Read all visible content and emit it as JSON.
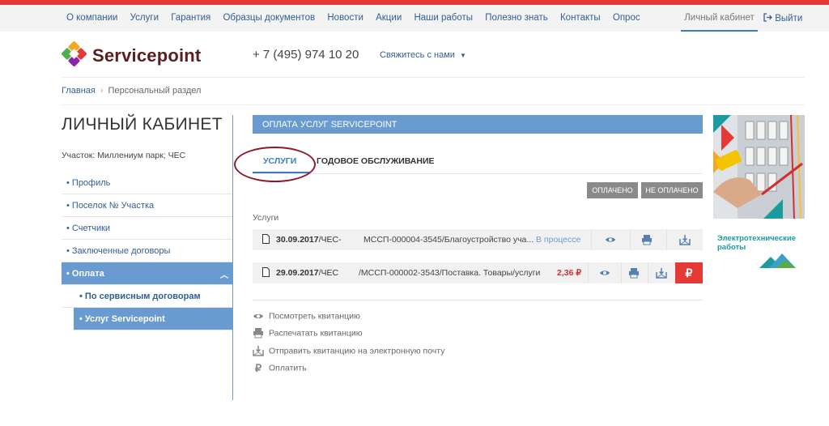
{
  "topnav": {
    "items": [
      "О компании",
      "Услуги",
      "Гарантия",
      "Образцы документов",
      "Новости",
      "Акции",
      "Наши работы",
      "Полезно знать",
      "Контакты",
      "Опрос"
    ],
    "cabinet": "Личный кабинет",
    "exit": "Выйти"
  },
  "header": {
    "logo_text": "Servicepoint",
    "phone": "+ 7 (495) 974 10 20",
    "contact": "Свяжитесь с нами"
  },
  "breadcrumb": {
    "home": "Главная",
    "current": "Персональный раздел"
  },
  "page": {
    "title": "ЛИЧНЫЙ КАБИНЕТ",
    "site_label": "Участок: Миллениум парк; ЧЕС"
  },
  "sidebar": {
    "items": [
      {
        "label": "• Профиль"
      },
      {
        "label": "• Поселок № Участка"
      },
      {
        "label": "• Счетчики"
      },
      {
        "label": "• Заключенные договоры"
      },
      {
        "label": "• Оплата"
      },
      {
        "label": "• По сервисным договорам"
      },
      {
        "label": "• Услуг Servicepoint"
      }
    ]
  },
  "panel": {
    "title": "ОПЛАТА УСЛУГ SERVICEPOINT",
    "tabs": [
      "УСЛУГИ",
      "ГОДОВОЕ ОБСЛУЖИВАНИЕ"
    ],
    "filters": {
      "paid": "ОПЛАЧЕНО",
      "unpaid": "НЕ ОПЛАЧЕНО"
    },
    "section_label": "Услуги",
    "rows": [
      {
        "date": "30.09.2017",
        "suffix": "/ЧЕС-",
        "desc": "МССП-000004-3545/Благоустройство уча...",
        "status": "В процессе"
      },
      {
        "date": "29.09.2017",
        "suffix": "/ЧЕС",
        "desc": "/МССП-000002-3543/Поставка. Товары/услуги",
        "amount": "2,36 ₽"
      }
    ],
    "rub_symbol": "₽",
    "legend": [
      {
        "icon": "eye-icon",
        "label": "Посмотреть квитанцию"
      },
      {
        "icon": "print-icon",
        "label": "Распечатать квитанцию"
      },
      {
        "icon": "mail-icon",
        "label": "Отправить квитанцию на электронную почту"
      },
      {
        "icon": "ruble-icon",
        "label": "Оплатить"
      }
    ]
  },
  "ad": {
    "text": "Электротехнические работы"
  },
  "colors": {
    "accent": "#6a9bd0",
    "link": "#2f5f93",
    "red": "#e53935",
    "annotation": "#8b1c2c"
  }
}
